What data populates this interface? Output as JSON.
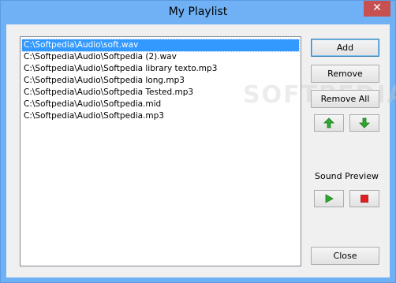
{
  "window": {
    "title": "My Playlist",
    "close_glyph": "✕"
  },
  "playlist": {
    "items": [
      "C:\\Softpedia\\Audio\\soft.wav",
      "C:\\Softpedia\\Audio\\Softpedia (2).wav",
      "C:\\Softpedia\\Audio\\Softpedia library texto.mp3",
      "C:\\Softpedia\\Audio\\Softpedia long.mp3",
      "C:\\Softpedia\\Audio\\Softpedia Tested.mp3",
      "C:\\Softpedia\\Audio\\Softpedia.mid",
      "C:\\Softpedia\\Audio\\Softpedia.mp3"
    ],
    "selected_index": 0
  },
  "buttons": {
    "add": "Add",
    "remove": "Remove",
    "remove_all": "Remove All",
    "close": "Close"
  },
  "move": {
    "up_icon": "arrow-up-icon",
    "down_icon": "arrow-down-icon",
    "arrow_color": "#2ea82e"
  },
  "preview": {
    "label": "Sound Preview",
    "play_icon": "play-icon",
    "stop_icon": "stop-icon",
    "play_color": "#2ea82e",
    "stop_color": "#e02020"
  },
  "watermark": "SOFTPEDIA"
}
